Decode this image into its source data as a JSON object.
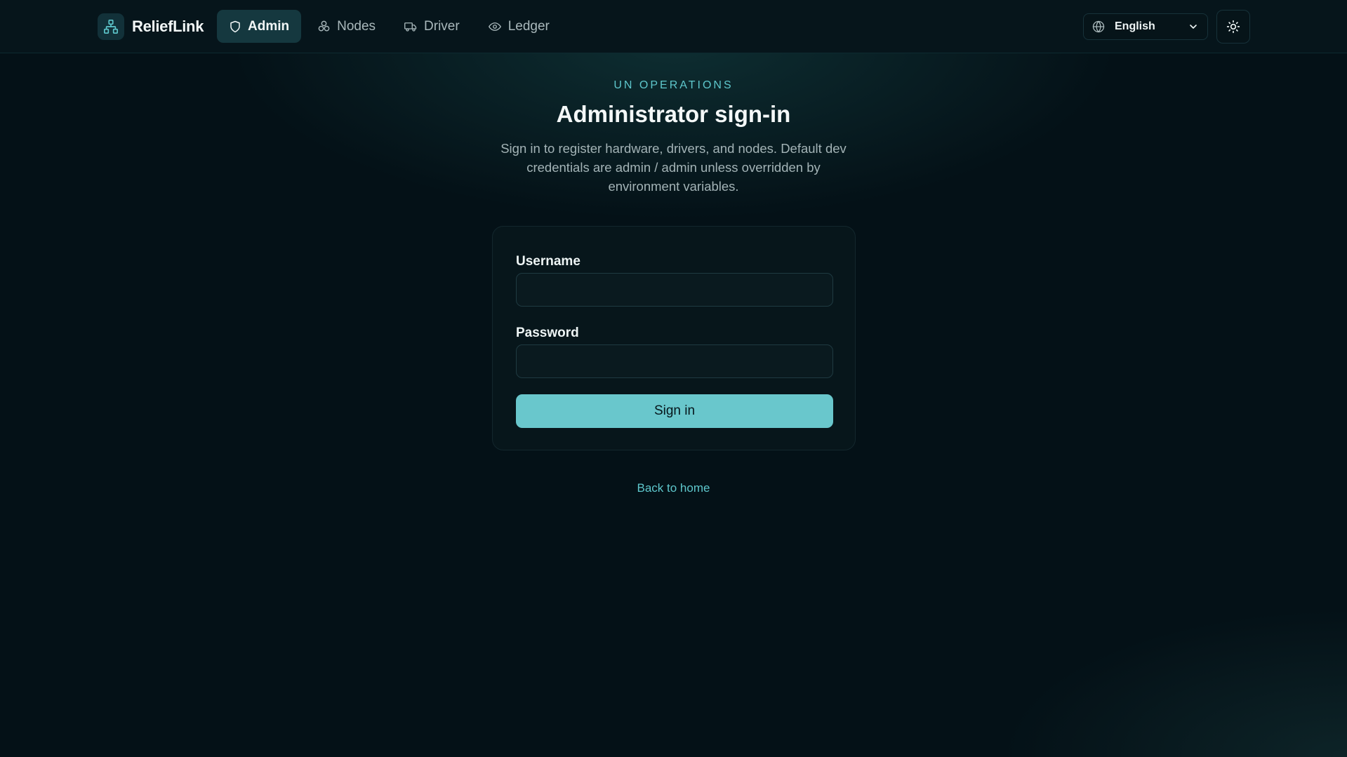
{
  "brand": {
    "name": "ReliefLink",
    "logo_icon": "network-icon"
  },
  "nav": {
    "items": [
      {
        "label": "Admin",
        "icon": "shield-icon",
        "active": true
      },
      {
        "label": "Nodes",
        "icon": "nodes-icon",
        "active": false
      },
      {
        "label": "Driver",
        "icon": "truck-icon",
        "active": false
      },
      {
        "label": "Ledger",
        "icon": "eye-icon",
        "active": false
      }
    ]
  },
  "language": {
    "selected": "English",
    "icon": "globe-icon"
  },
  "theme_toggle": {
    "icon": "sun-icon"
  },
  "hero": {
    "eyebrow": "UN OPERATIONS",
    "title": "Administrator sign-in",
    "subtitle": "Sign in to register hardware, drivers, and nodes. Default dev credentials are admin / admin unless overridden by environment variables."
  },
  "form": {
    "username_label": "Username",
    "username_value": "",
    "password_label": "Password",
    "password_value": "",
    "submit_label": "Sign in"
  },
  "back_link": "Back to home",
  "colors": {
    "background": "#041117",
    "accent": "#69c7cc",
    "active_nav": "#15383f"
  }
}
